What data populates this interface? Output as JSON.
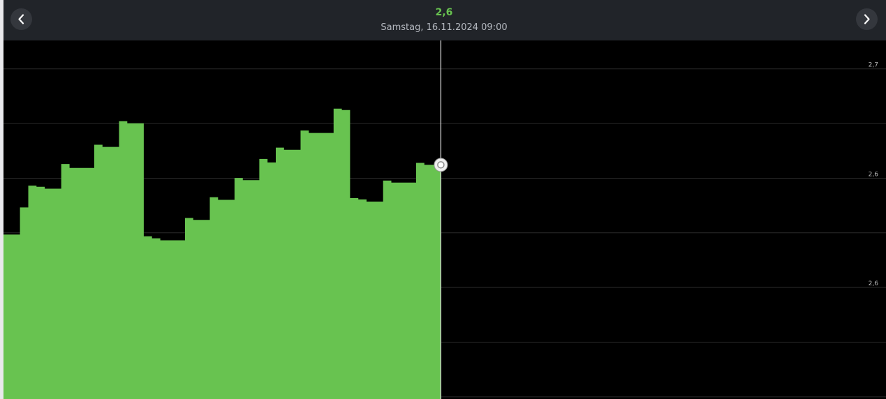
{
  "header": {
    "value": "2,6",
    "date": "Samstag, 16.11.2024 09:00",
    "prev_icon": "chevron-left-icon",
    "next_icon": "chevron-right-icon"
  },
  "colors": {
    "accent": "#68c350",
    "cursor_line": "#d0d0d0",
    "grid": "#2b2b2b",
    "background": "#000000",
    "header_bg": "#212429"
  },
  "chart_data": {
    "type": "area",
    "title": "",
    "xlabel": "",
    "ylabel": "",
    "y_tick_labels": [
      "2,7",
      "2,6",
      "2,6"
    ],
    "y_tick_values": [
      2.7,
      2.65,
      2.6
    ],
    "ylim": [
      2.549,
      2.713
    ],
    "grid": true,
    "y_axis_position": "right",
    "cursor_index": 53,
    "total_slots": 105,
    "values": [
      2.6242,
      2.6242,
      2.6366,
      2.6466,
      2.6461,
      2.6452,
      2.6452,
      2.6565,
      2.6547,
      2.6547,
      2.6547,
      2.6653,
      2.6643,
      2.6643,
      2.6761,
      2.6751,
      2.6751,
      2.6234,
      2.6225,
      2.6216,
      2.6216,
      2.6216,
      2.6318,
      2.6309,
      2.6309,
      2.6413,
      2.6401,
      2.6401,
      2.6501,
      2.6491,
      2.6491,
      2.6588,
      2.6572,
      2.664,
      2.663,
      2.663,
      2.6718,
      2.6707,
      2.6707,
      2.6707,
      2.6818,
      2.6812,
      2.6409,
      2.6403,
      2.6393,
      2.6393,
      2.6489,
      2.648,
      2.648,
      2.648,
      2.657,
      2.6561,
      2.6561,
      2.6561
    ],
    "series": [
      {
        "values_ref": "values",
        "color": "#68c350"
      }
    ]
  }
}
